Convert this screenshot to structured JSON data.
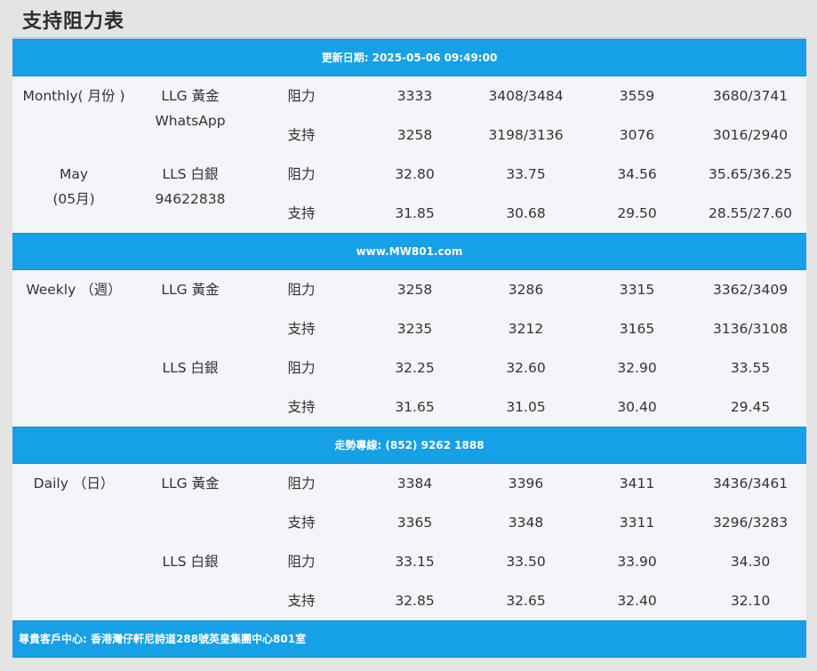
{
  "title": "支持阻力表",
  "banners": {
    "updated": "更新日期: 2025-05-06 09:49:00",
    "website": "www.MW801.com",
    "hotline": "走勢專線: (852) 9262 1888",
    "address": "尊貴客戶中心: 香港灣仔軒尼詩道288號英皇集團中心801室"
  },
  "labels": {
    "resistance": "阻力",
    "support": "支持"
  },
  "sections": [
    {
      "period_line1": "Monthly( 月份 )",
      "period_line2": "May",
      "period_line3": "(05月)",
      "gold_label": "LLG 黃金",
      "gold_extra": "WhatsApp",
      "silver_label": "LLS 白銀",
      "silver_extra": "94622838",
      "rows": [
        [
          "3333",
          "3408/3484",
          "3559",
          "3680/3741"
        ],
        [
          "3258",
          "3198/3136",
          "3076",
          "3016/2940"
        ],
        [
          "32.80",
          "33.75",
          "34.56",
          "35.65/36.25"
        ],
        [
          "31.85",
          "30.68",
          "29.50",
          "28.55/27.60"
        ]
      ]
    },
    {
      "period_line1": "Weekly （週）",
      "gold_label": "LLG 黃金",
      "silver_label": "LLS 白銀",
      "rows": [
        [
          "3258",
          "3286",
          "3315",
          "3362/3409"
        ],
        [
          "3235",
          "3212",
          "3165",
          "3136/3108"
        ],
        [
          "32.25",
          "32.60",
          "32.90",
          "33.55"
        ],
        [
          "31.65",
          "31.05",
          "30.40",
          "29.45"
        ]
      ]
    },
    {
      "period_line1": "Daily （日）",
      "gold_label": "LLG 黃金",
      "silver_label": "LLS 白銀",
      "rows": [
        [
          "3384",
          "3396",
          "3411",
          "3436/3461"
        ],
        [
          "3365",
          "3348",
          "3311",
          "3296/3283"
        ],
        [
          "33.15",
          "33.50",
          "33.90",
          "34.30"
        ],
        [
          "32.85",
          "32.65",
          "32.40",
          "32.10"
        ]
      ]
    }
  ]
}
